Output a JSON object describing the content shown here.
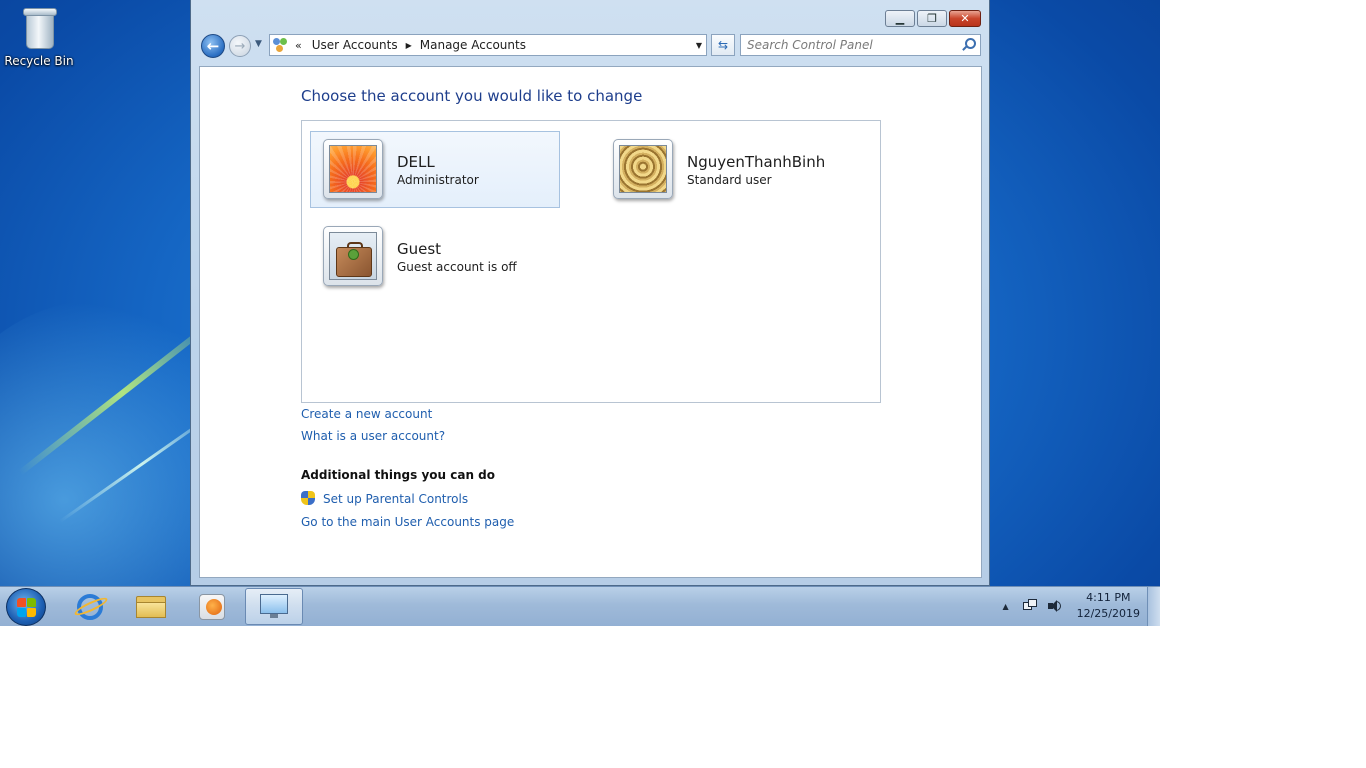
{
  "desktop": {
    "icons": [
      {
        "label": "Recycle Bin",
        "icon": "recycle-bin-icon"
      }
    ]
  },
  "window": {
    "caption_buttons": [
      "minimize",
      "maximize",
      "close"
    ],
    "nav": {
      "back_glyph": "←",
      "forward_glyph": "→",
      "breadcrumb_prefix": "«",
      "breadcrumb": [
        "User Accounts",
        "Manage Accounts"
      ],
      "search_placeholder": "Search Control Panel"
    },
    "heading": "Choose the account you would like to change",
    "accounts": [
      {
        "name": "DELL",
        "role": "Administrator",
        "picture": "orange-flower",
        "selected": true
      },
      {
        "name": "NguyenThanhBinh",
        "role": "Standard user",
        "picture": "nautilus-shell",
        "selected": false
      },
      {
        "name": "Guest",
        "role": "Guest account is off",
        "picture": "briefcase",
        "selected": false
      }
    ],
    "links": {
      "create_account": "Create a new account",
      "what_is_account": "What is a user account?"
    },
    "additional": {
      "heading": "Additional things you can do",
      "parental_controls": "Set up Parental Controls",
      "main_page": "Go to the main User Accounts page"
    }
  },
  "taskbar": {
    "pinned": [
      {
        "name": "internet-explorer",
        "active": false
      },
      {
        "name": "windows-explorer",
        "active": false
      },
      {
        "name": "windows-media-player",
        "active": false
      },
      {
        "name": "control-panel",
        "active": true
      }
    ],
    "clock": {
      "time": "4:11 PM",
      "date": "12/25/2019"
    }
  }
}
